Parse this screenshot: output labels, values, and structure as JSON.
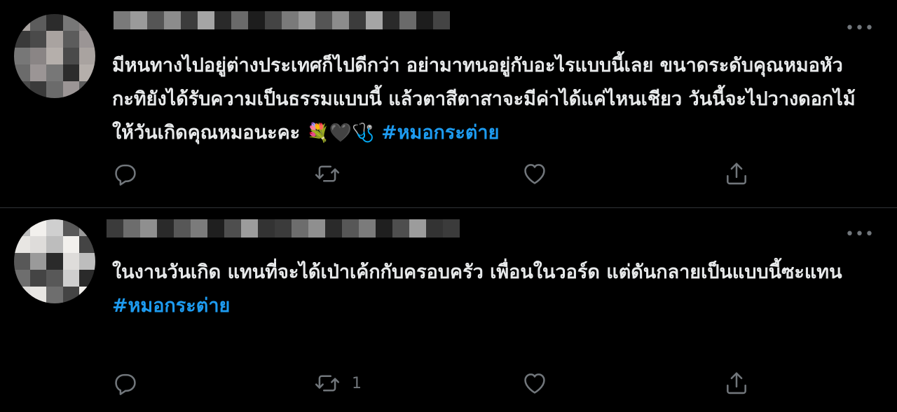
{
  "tweets": [
    {
      "more_label": "•••",
      "text_main": "มีหนทางไปอยู่ต่างประเทศก็ไปดีกว่า อย่ามาทนอยู่กับอะไรแบบนี้เลย ขนาดระดับคุณหมอหัวกะทิยังได้รับความเป็นธรรมแบบนี้ แล้วตาสีตาสาจะมีค่าได้แค่ไหนเชียว วันนี้จะไปวางดอกไม้ให้วันเกิดคุณหมอนะคะ ",
      "emojis": "💐🖤🩺",
      "hashtag": "#หมอกระต่าย",
      "retweet_count": "",
      "icons": [
        "reply-icon",
        "retweet-icon",
        "like-icon",
        "share-icon"
      ]
    },
    {
      "more_label": "•••",
      "text_line1": "ในงานวันเกิด แทนที่จะได้เป่าเค้กกับครอบครัว เพื่อนในวอร์ด แต่ดันกลายเป็นแบบนี้ซะแทน",
      "hashtag": "#หมอกระต่าย",
      "retweet_count": "1",
      "icons": [
        "reply-icon",
        "retweet-icon",
        "like-icon",
        "share-icon"
      ]
    }
  ],
  "colors": {
    "background": "#000000",
    "text": "#e7e9ea",
    "muted": "#71767b",
    "hashtag": "#1d9bf0",
    "divider": "#2f3336"
  }
}
